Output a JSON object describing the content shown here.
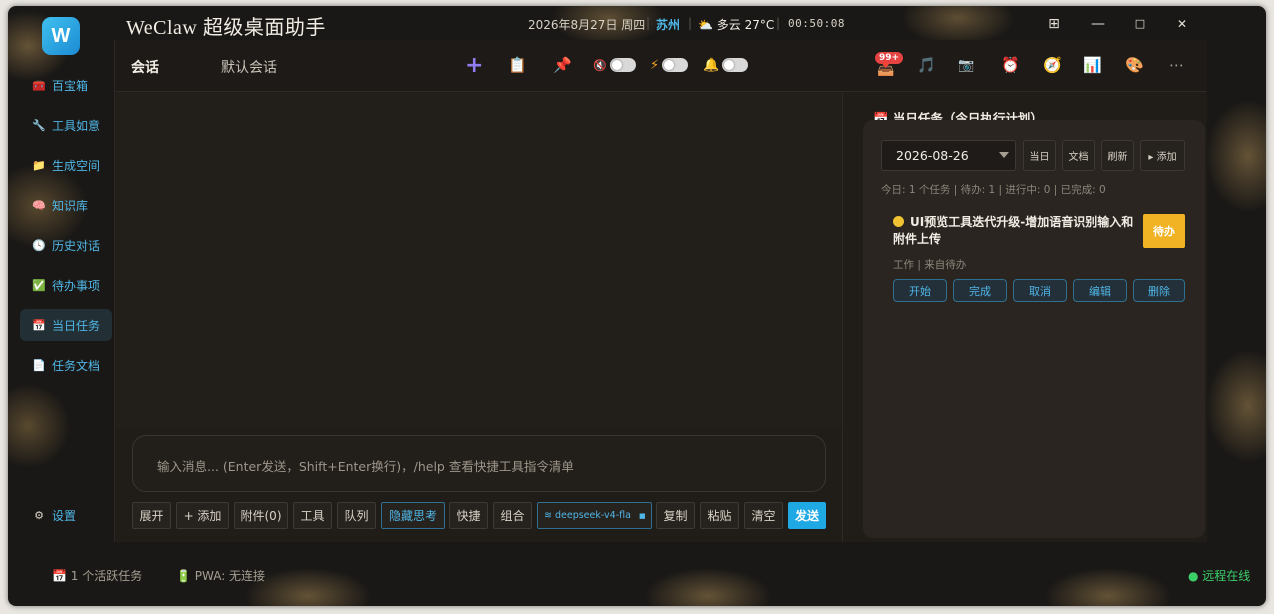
{
  "app": {
    "logo_letter": "W",
    "title": "WeClaw 超级桌面助手"
  },
  "titlebar": {
    "date": "2026年8月27日 周四",
    "city": "苏州",
    "weather": "⛅ 多云 27°C",
    "time": "00:50:08"
  },
  "window_controls": {
    "layout": "⊞",
    "minimize": "—",
    "maximize": "□",
    "close": "✕"
  },
  "sidebar": {
    "items": [
      {
        "label": "百宝箱",
        "icon": "🧰"
      },
      {
        "label": "工具如意",
        "icon": "🔧"
      },
      {
        "label": "生成空间",
        "icon": "📁"
      },
      {
        "label": "知识库",
        "icon": "🧠"
      },
      {
        "label": "历史对话",
        "icon": "🕓"
      },
      {
        "label": "待办事项",
        "icon": "✅"
      },
      {
        "label": "当日任务",
        "icon": "📅"
      },
      {
        "label": "任务文档",
        "icon": "📄"
      }
    ],
    "settings": {
      "label": "设置",
      "icon": "⚙"
    }
  },
  "header": {
    "tab_chat": "会话",
    "tab_session": "默认会话",
    "badge": "99+"
  },
  "input": {
    "placeholder": "输入消息... (Enter发送，Shift+Enter换行)，/help 查看快捷工具指令清单"
  },
  "toolbar": {
    "expand": "展开",
    "add": "+ 添加",
    "attach": "附件(0)",
    "tools": "工具",
    "queue": "队列",
    "hide_thinking": "隐藏思考",
    "quick": "快捷",
    "combo": "组合",
    "model": "deepseek-v4-fla",
    "copy": "复制",
    "paste": "粘贴",
    "clear": "清空",
    "send": "发送"
  },
  "right_panel": {
    "title": "📅 当日任务（今日执行计划）",
    "date": "2026-08-26",
    "btn_today": "当日",
    "btn_doc": "文档",
    "btn_refresh": "刷新",
    "btn_add": "▸ 添加",
    "stats": "今日: 1 个任务 | 待办: 1 | 进行中: 0 | 已完成: 0",
    "task": {
      "title": "UI预览工具迭代升级-增加语音识别输入和附件上传",
      "status": "待办",
      "meta": "工作 | 来自待办",
      "actions": [
        "开始",
        "完成",
        "取消",
        "编辑",
        "删除"
      ]
    }
  },
  "statusbar": {
    "tasks": "📅 1 个活跃任务",
    "pwa": "🔋 PWA: 无连接",
    "online": "● 远程在线"
  }
}
